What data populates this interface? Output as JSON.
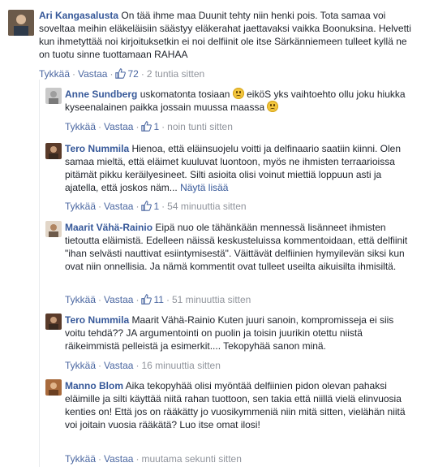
{
  "comments": [
    {
      "author": "Ari Kangasalusta",
      "text": "On tää ihme maa Duunit tehty niin henki pois. Tota samaa voi soveltaa meihin eläkeläisiin säästyy eläkerahat jaettavaksi vaikka Boonuksina. Helvetti kun ihmetyttää noi kirjoituksetkin ei noi delfiinit ole itse Särkänniemeen tulleet kyllä ne on tuotu sinne tuottamaan RAHAA",
      "like": "Tykkää",
      "reply": "Vastaa",
      "likes": "72",
      "time": "2 tuntia sitten"
    },
    {
      "author": "Anne Sundberg",
      "text": "uskomatonta tosiaan",
      "text2": "eiköS yks vaihtoehto ollu joku hiukka kyseenalainen paikka jossain muussa maassa",
      "like": "Tykkää",
      "reply": "Vastaa",
      "likes": "1",
      "time": "noin tunti sitten"
    },
    {
      "author": "Tero Nummila",
      "text": "Hienoa, että eläinsuojelu voitti ja delfinaario saatiin kiinni. Olen samaa mieltä, että eläimet kuuluvat luontoon, myös ne ihmisten terraarioissa pitämät pikku keräilyesineet. Silti asioita olisi voinut miettiä loppuun asti ja ajatella, että joskos näm...",
      "see_more": "Näytä lisää",
      "like": "Tykkää",
      "reply": "Vastaa",
      "likes": "1",
      "time": "54 minuuttia sitten"
    },
    {
      "author": "Maarit Vähä-Rainio",
      "text": "Eipä nuo ole tähänkään mennessä lisänneet ihmisten tietoutta eläimistä. Edelleen näissä keskusteluissa kommentoidaan, että delfiinit \"ihan selvästi nauttivat esiintymisestä\". Väittävät delfiinien hymyilevän siksi kun ovat niin onnellisia. Ja nämä kommentit ovat tulleet useilta aikuisilta ihmisiltä.",
      "like": "Tykkää",
      "reply": "Vastaa",
      "likes": "11",
      "time": "51 minuuttia sitten"
    },
    {
      "author": "Tero Nummila",
      "text": "Maarit Vähä-Rainio Kuten juuri sanoin, kompromisseja ei siis voitu tehdä?? JA argumentointi on puolin ja toisin juurikin otettu niistä räikeimmistä pelleistä ja esimerkit.... Tekopyhää sanon minä.",
      "like": "Tykkää",
      "reply": "Vastaa",
      "time": "16 minuuttia sitten"
    },
    {
      "author": "Manno Blom",
      "text": "Aika tekopyhää olisi myöntää delfiinien pidon olevan pahaksi eläimille ja silti käyttää niitä rahan tuottoon, sen takia että niillä vielä elinvuosia kenties on! Että jos on rääkätty jo vuosikymmeniä niin mitä sitten, vielähän niitä voi joitain vuosia rääkätä? Luo itse omat ilosi!",
      "like": "Tykkää",
      "reply": "Vastaa",
      "time": "muutama sekunti sitten"
    }
  ],
  "colors": {
    "author": "#365899",
    "link": "#4b67a1",
    "meta": "#90949c"
  }
}
